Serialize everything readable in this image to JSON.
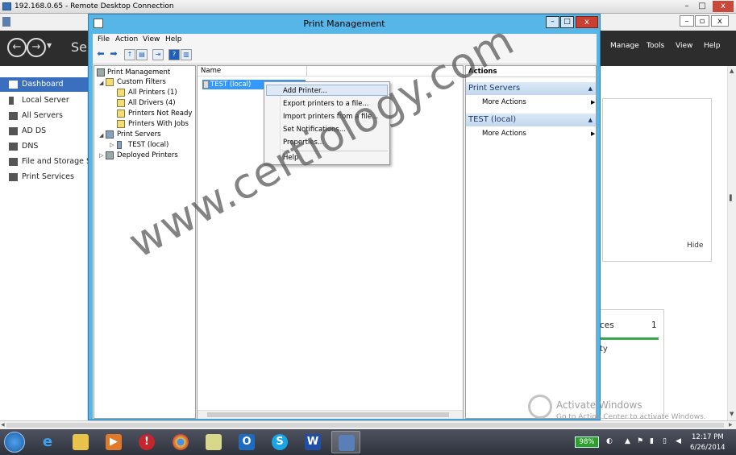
{
  "rdp": {
    "title": "192.168.0.65 - Remote Desktop Connection",
    "min": "–",
    "max": "□",
    "close": "x"
  },
  "server_manager": {
    "title": "Ser",
    "host_controls": {
      "min": "–",
      "max": "▫",
      "close": "x"
    },
    "menu": [
      "Manage",
      "Tools",
      "View",
      "Help"
    ],
    "sidebar": [
      {
        "label": "Dashboard",
        "active": true
      },
      {
        "label": "Local Server"
      },
      {
        "label": "All Servers"
      },
      {
        "label": "AD DS"
      },
      {
        "label": "DNS"
      },
      {
        "label": "File and Storage Ser"
      },
      {
        "label": "Print Services"
      }
    ],
    "hide_label": "Hide",
    "tile": {
      "text": "ces",
      "count": "1",
      "sub": "ty"
    }
  },
  "print_management": {
    "title": "Print Management",
    "controls": {
      "min": "–",
      "max": "□",
      "close": "x"
    },
    "menu": [
      "File",
      "Action",
      "View",
      "Help"
    ],
    "tree": {
      "root": "Print Management",
      "custom_filters": "Custom Filters",
      "filters": [
        "All Printers (1)",
        "All Drivers (4)",
        "Printers Not Ready",
        "Printers With Jobs"
      ],
      "print_servers": "Print Servers",
      "server": "TEST (local)",
      "deployed": "Deployed Printers"
    },
    "list": {
      "column": "Name",
      "row": "TEST (local)"
    },
    "context_menu": {
      "items": [
        "Add Printer...",
        "Export printers to a file...",
        "Import printers from a file...",
        "Set Notifications...",
        "Properties..."
      ],
      "help": "Help"
    },
    "actions": {
      "header": "Actions",
      "groups": [
        {
          "title": "Print Servers",
          "item": "More Actions"
        },
        {
          "title": "TEST (local)",
          "item": "More Actions"
        }
      ]
    }
  },
  "watermark": "www.certiology.com",
  "activation": {
    "title": "Activate Windows",
    "sub": "Go to Action Center to activate Windows."
  },
  "taskbar": {
    "battery": "98%",
    "time": "12:17 PM",
    "date": "6/26/2014"
  },
  "colors": {
    "accent": "#3a6fbf",
    "pm_frame": "#57b6e8",
    "selection": "#3399ff"
  }
}
